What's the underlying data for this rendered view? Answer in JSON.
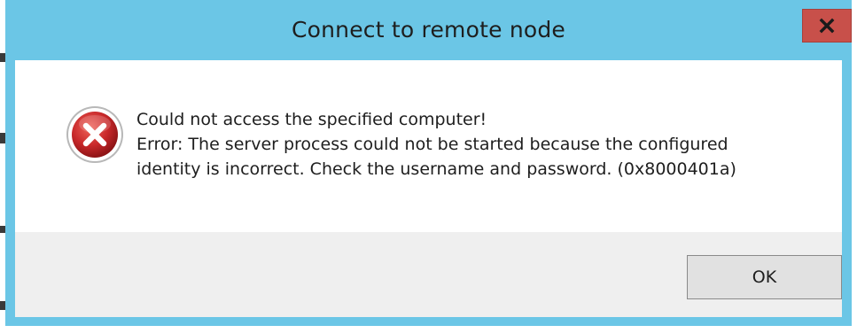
{
  "dialog": {
    "title": "Connect to remote node",
    "close_label": "x",
    "message_lines": [
      "Could not access the specified computer!",
      "Error: The server process could not be started because the configured",
      "identity is incorrect. Check the username and password. (0x8000401a)"
    ],
    "ok_label": "OK",
    "icon": "error-icon"
  },
  "colors": {
    "titlebar": "#6bc6e6",
    "close_button": "#c8504a",
    "error_icon": "#c8282a",
    "footer": "#efefef"
  }
}
